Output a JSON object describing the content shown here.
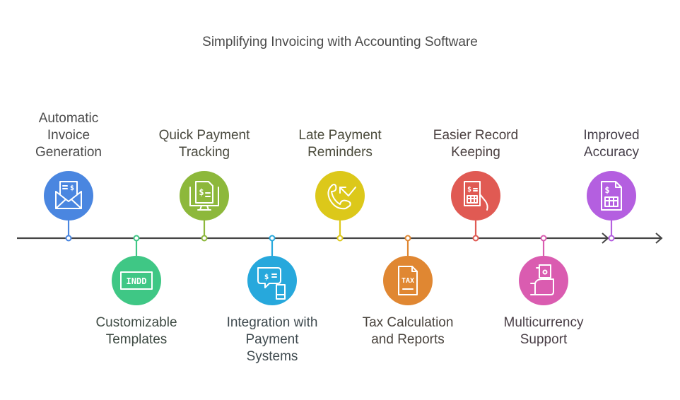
{
  "title": "Simplifying Invoicing with Accounting Software",
  "axis_color": "#454545",
  "items": [
    {
      "lines": [
        "Automatic",
        "Invoice",
        "Generation"
      ],
      "side": "top",
      "color": "#4a86e0",
      "text_color": "#4a4a4a",
      "icon": "envelope-invoice-icon"
    },
    {
      "lines": [
        "Customizable",
        "Templates"
      ],
      "side": "bottom",
      "color": "#3fc785",
      "text_color": "#3f4b44",
      "icon": "indd-file-icon"
    },
    {
      "lines": [
        "Quick Payment",
        "Tracking"
      ],
      "side": "top",
      "color": "#8db83b",
      "text_color": "#4a4a3f",
      "icon": "monitor-invoice-icon"
    },
    {
      "lines": [
        "Integration with",
        "Payment",
        "Systems"
      ],
      "side": "bottom",
      "color": "#27a8dc",
      "text_color": "#3f4a4f",
      "icon": "chat-payment-phone-icon"
    },
    {
      "lines": [
        "Late Payment",
        "Reminders"
      ],
      "side": "top",
      "color": "#dcc81a",
      "text_color": "#4a4a3a",
      "icon": "phone-callback-icon"
    },
    {
      "lines": [
        "Tax Calculation",
        "and Reports"
      ],
      "side": "bottom",
      "color": "#e08732",
      "text_color": "#4a443e",
      "icon": "tax-document-icon"
    },
    {
      "lines": [
        "Easier Record",
        "Keeping"
      ],
      "side": "top",
      "color": "#e05a53",
      "text_color": "#4a3f3f",
      "icon": "hand-invoice-icon"
    },
    {
      "lines": [
        "Multicurrency",
        "Support"
      ],
      "side": "bottom",
      "color": "#da5cb0",
      "text_color": "#4a3f47",
      "icon": "hand-cash-icon"
    },
    {
      "lines": [
        "Improved",
        "Accuracy"
      ],
      "side": "top",
      "color": "#b45fe0",
      "text_color": "#463f4a",
      "icon": "invoice-table-icon"
    }
  ]
}
